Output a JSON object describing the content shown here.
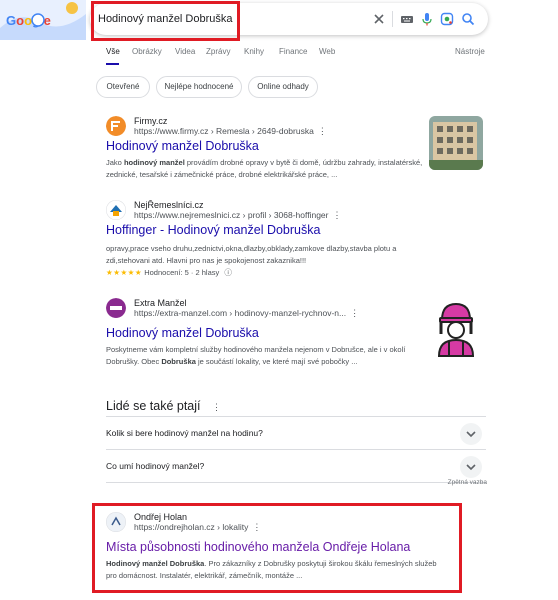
{
  "search": {
    "query": "Hodinový manžel Dobruška",
    "google_logo_text": "Google"
  },
  "tabs": [
    {
      "label": "Vše"
    },
    {
      "label": "Obrázky"
    },
    {
      "label": "Videa"
    },
    {
      "label": "Zprávy"
    },
    {
      "label": "Knihy"
    },
    {
      "label": "Finance"
    },
    {
      "label": "Web"
    }
  ],
  "tools_label": "Nástroje",
  "chips": [
    {
      "label": "Otevřené"
    },
    {
      "label": "Nejlépe hodnocené"
    },
    {
      "label": "Online odhady"
    }
  ],
  "results": [
    {
      "site": "Firmy.cz",
      "url": "https://www.firmy.cz › Remesla › 2649-dobruska",
      "title": "Hodinový manžel Dobruška",
      "snippet_html": "Jako <b>hodinový manžel</b> provádím drobné opravy v bytě či domě, údržbu zahrady, instalatérské, zednické, tesařské i zámečnické práce, drobné elektrikářské práce, ..."
    },
    {
      "site": "NejŘemeslníci.cz",
      "url": "https://www.nejremeslnici.cz › profil › 3068-hoffinger",
      "title": "Hoffinger - Hodinový manžel Dobruška",
      "snippet_html": "opravy,prace vseho druhu,zednictvi,okna,dlazby,obklady,zamkove dlazby,stavba plotu a zdi,stehovani atd. Hlavni pro nas je spokojenost zakaznika!!!",
      "stars": "★★★★★",
      "rating_text": "Hodnocení: 5 · 2 hlasy",
      "rating_value": 5
    },
    {
      "site": "Extra Manžel",
      "url": "https://extra-manzel.com › hodinovy-manzel-rychnov-n...",
      "title": "Hodinový manžel Dobruška",
      "snippet_html": "Poskytneme vám kompletní služby hodinového manžela nejenom v Dobrušce, ale i v okolí Dobrušky. Obec <b>Dobruška</b> je součástí lokality, ve které mají své pobočky ..."
    },
    {
      "site": "Ondřej Holan",
      "url": "https://ondrejholan.cz › lokality",
      "title": "Místa působnosti hodinového manžela Ondřeje Holana",
      "snippet_html": "<b>Hodinový manžel Dobruška</b>. Pro zákazníky z Dobrušky poskytuji širokou škálu řemeslných služeb pro domácnost. Instalatér, elektrikář, zámečník, montáže ..."
    }
  ],
  "paa": {
    "title": "Lidé se také ptají",
    "questions": [
      {
        "text": "Kolik si bere hodinový manžel na hodinu?"
      },
      {
        "text": "Co umí hodinový manžel?"
      }
    ],
    "feedback": "Zpětná vazba"
  },
  "colors": {
    "link": "#1a0dab",
    "visited": "#681da8",
    "highlight": "#e01b24",
    "star": "#fbbc04"
  }
}
